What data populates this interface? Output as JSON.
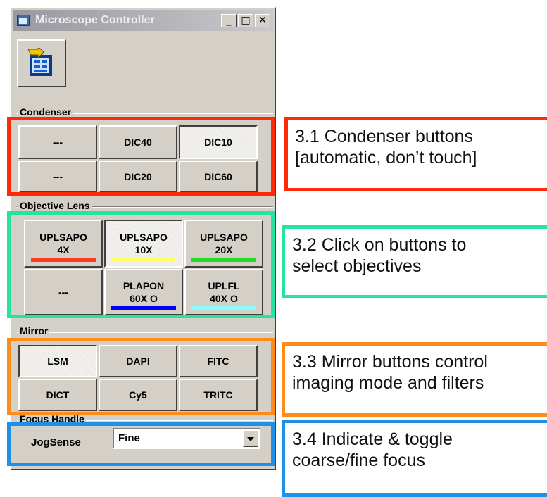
{
  "window": {
    "title": "Microscope Controller",
    "controls": {
      "minimize": "_",
      "maximize": "□",
      "close": "✕"
    },
    "toolbar_icon": "load-config-icon"
  },
  "condenser": {
    "label": "Condenser",
    "buttons": [
      {
        "label": "---",
        "pressed": false
      },
      {
        "label": "DIC40",
        "pressed": false
      },
      {
        "label": "DIC10",
        "pressed": true
      },
      {
        "label": "---",
        "pressed": false
      },
      {
        "label": "DIC20",
        "pressed": false
      },
      {
        "label": "DIC60",
        "pressed": false
      }
    ]
  },
  "objective": {
    "label": "Objective Lens",
    "buttons": [
      {
        "line1": "UPLSAPO",
        "line2": "4X",
        "stripe": "#ff3b1f",
        "pressed": false
      },
      {
        "line1": "UPLSAPO",
        "line2": "10X",
        "stripe": "#ffff66",
        "pressed": true
      },
      {
        "line1": "UPLSAPO",
        "line2": "20X",
        "stripe": "#22dd22",
        "pressed": false
      },
      {
        "line1": "---",
        "line2": "",
        "stripe": "",
        "pressed": false
      },
      {
        "line1": "PLAPON",
        "line2": "60X O",
        "stripe": "#0000ee",
        "pressed": false
      },
      {
        "line1": "UPLFL",
        "line2": "40X O",
        "stripe": "#88ffff",
        "pressed": false
      }
    ]
  },
  "mirror": {
    "label": "Mirror",
    "buttons": [
      {
        "label": "LSM",
        "pressed": true
      },
      {
        "label": "DAPI",
        "pressed": false
      },
      {
        "label": "FITC",
        "pressed": false
      },
      {
        "label": "DICT",
        "pressed": false
      },
      {
        "label": "Cy5",
        "pressed": false
      },
      {
        "label": "TRITC",
        "pressed": false
      }
    ]
  },
  "focus": {
    "label": "Focus Handle",
    "jog_label": "JogSense",
    "jog_value": "Fine"
  },
  "annotations": {
    "condenser": {
      "color": "#ff2a0a",
      "lines": [
        "3.1 Condenser buttons",
        "[automatic, don’t touch]"
      ]
    },
    "objective": {
      "color": "#27e3a0",
      "lines": [
        "3.2 Click on buttons to",
        "select objectives"
      ]
    },
    "mirror": {
      "color": "#ff8c1a",
      "lines": [
        "3.3 Mirror buttons control",
        "imaging mode and filters"
      ]
    },
    "focus": {
      "color": "#1e90e8",
      "lines": [
        "3.4 Indicate & toggle",
        "coarse/fine focus"
      ]
    }
  }
}
